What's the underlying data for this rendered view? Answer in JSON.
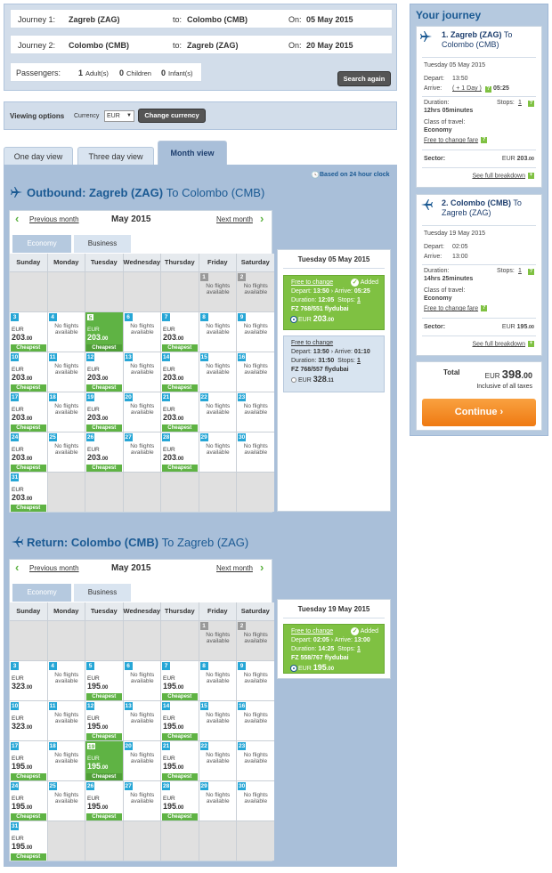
{
  "search": {
    "journey1": {
      "label": "Journey 1:",
      "from": "Zagreb (ZAG)",
      "to_label": "to:",
      "to": "Colombo (CMB)",
      "on_label": "On:",
      "date": "05 May 2015"
    },
    "journey2": {
      "label": "Journey 2:",
      "from": "Colombo (CMB)",
      "to_label": "to:",
      "to": "Zagreb (ZAG)",
      "on_label": "On:",
      "date": "20 May 2015"
    },
    "passengers": {
      "label": "Passengers:",
      "adults": "1",
      "adults_label": "Adult(s)",
      "children": "0",
      "children_label": "Children",
      "infants": "0",
      "infants_label": "Infant(s)"
    },
    "search_again": "Search again"
  },
  "viewing": {
    "label": "Viewing options",
    "currency_label": "Currency",
    "currency": "EUR",
    "change_btn": "Change currency"
  },
  "tabs": [
    "One day view",
    "Three day view",
    "Month view"
  ],
  "clock_note": "Based on 24 hour clock",
  "outbound": {
    "prefix": "Outbound:",
    "from": "Zagreb (ZAG)",
    "to_word": "To",
    "to": "Colombo (CMB)"
  },
  "return": {
    "prefix": "Return:",
    "from": "Colombo (CMB)",
    "to_word": "To",
    "to": "Zagreb (ZAG)"
  },
  "calendar": {
    "prev": "Previous month",
    "next": "Next month",
    "month": "May 2015",
    "cabin_tabs": [
      "Economy",
      "Business"
    ],
    "days": [
      "Sunday",
      "Monday",
      "Tuesday",
      "Wednesday",
      "Thursday",
      "Friday",
      "Saturday"
    ],
    "no_flights": "No flights available",
    "cheapest": "Cheapest",
    "currency": "EUR"
  },
  "out_cells": [
    {
      "d": ""
    },
    {
      "d": ""
    },
    {
      "d": ""
    },
    {
      "d": ""
    },
    {
      "d": ""
    },
    {
      "d": "1",
      "nf": 1
    },
    {
      "d": "2",
      "nf": 1
    },
    {
      "d": "3",
      "p": "203",
      "c": "00",
      "ch": 1
    },
    {
      "d": "4",
      "nf": 1
    },
    {
      "d": "5",
      "p": "203",
      "c": "00",
      "ch": 1,
      "sel": 1
    },
    {
      "d": "6",
      "nf": 1
    },
    {
      "d": "7",
      "p": "203",
      "c": "00",
      "ch": 1
    },
    {
      "d": "8",
      "nf": 1
    },
    {
      "d": "9",
      "nf": 1
    },
    {
      "d": "10",
      "p": "203",
      "c": "00",
      "ch": 1
    },
    {
      "d": "11",
      "nf": 1
    },
    {
      "d": "12",
      "p": "203",
      "c": "00",
      "ch": 1
    },
    {
      "d": "13",
      "nf": 1
    },
    {
      "d": "14",
      "p": "203",
      "c": "00",
      "ch": 1
    },
    {
      "d": "15",
      "nf": 1
    },
    {
      "d": "16",
      "nf": 1
    },
    {
      "d": "17",
      "p": "203",
      "c": "00",
      "ch": 1
    },
    {
      "d": "18",
      "nf": 1
    },
    {
      "d": "19",
      "p": "203",
      "c": "00",
      "ch": 1
    },
    {
      "d": "20",
      "nf": 1
    },
    {
      "d": "21",
      "p": "203",
      "c": "00",
      "ch": 1
    },
    {
      "d": "22",
      "nf": 1
    },
    {
      "d": "23",
      "nf": 1
    },
    {
      "d": "24",
      "p": "203",
      "c": "00",
      "ch": 1
    },
    {
      "d": "25",
      "nf": 1
    },
    {
      "d": "26",
      "p": "203",
      "c": "00",
      "ch": 1
    },
    {
      "d": "27",
      "nf": 1
    },
    {
      "d": "28",
      "p": "203",
      "c": "00",
      "ch": 1
    },
    {
      "d": "29",
      "nf": 1
    },
    {
      "d": "30",
      "nf": 1
    },
    {
      "d": "31",
      "p": "203",
      "c": "00",
      "ch": 1
    },
    {
      "d": ""
    },
    {
      "d": ""
    },
    {
      "d": ""
    },
    {
      "d": ""
    },
    {
      "d": ""
    },
    {
      "d": ""
    }
  ],
  "ret_cells": [
    {
      "d": ""
    },
    {
      "d": ""
    },
    {
      "d": ""
    },
    {
      "d": ""
    },
    {
      "d": ""
    },
    {
      "d": "1",
      "nf": 1
    },
    {
      "d": "2",
      "nf": 1
    },
    {
      "d": "3",
      "p": "323",
      "c": "00"
    },
    {
      "d": "4",
      "nf": 1
    },
    {
      "d": "5",
      "p": "195",
      "c": "00",
      "ch": 1
    },
    {
      "d": "6",
      "nf": 1
    },
    {
      "d": "7",
      "p": "195",
      "c": "00",
      "ch": 1
    },
    {
      "d": "8",
      "nf": 1
    },
    {
      "d": "9",
      "nf": 1
    },
    {
      "d": "10",
      "p": "323",
      "c": "00"
    },
    {
      "d": "11",
      "nf": 1
    },
    {
      "d": "12",
      "p": "195",
      "c": "00",
      "ch": 1
    },
    {
      "d": "13",
      "nf": 1
    },
    {
      "d": "14",
      "p": "195",
      "c": "00",
      "ch": 1
    },
    {
      "d": "15",
      "nf": 1
    },
    {
      "d": "16",
      "nf": 1
    },
    {
      "d": "17",
      "p": "195",
      "c": "00",
      "ch": 1
    },
    {
      "d": "18",
      "nf": 1
    },
    {
      "d": "19",
      "p": "195",
      "c": "00",
      "ch": 1,
      "sel": 1
    },
    {
      "d": "20",
      "nf": 1
    },
    {
      "d": "21",
      "p": "195",
      "c": "00",
      "ch": 1
    },
    {
      "d": "22",
      "nf": 1
    },
    {
      "d": "23",
      "nf": 1
    },
    {
      "d": "24",
      "p": "195",
      "c": "00",
      "ch": 1
    },
    {
      "d": "25",
      "nf": 1
    },
    {
      "d": "26",
      "p": "195",
      "c": "00",
      "ch": 1
    },
    {
      "d": "27",
      "nf": 1
    },
    {
      "d": "28",
      "p": "195",
      "c": "00",
      "ch": 1
    },
    {
      "d": "29",
      "nf": 1
    },
    {
      "d": "30",
      "nf": 1
    },
    {
      "d": "31",
      "p": "195",
      "c": "00",
      "ch": 1
    },
    {
      "d": ""
    },
    {
      "d": ""
    },
    {
      "d": ""
    },
    {
      "d": ""
    },
    {
      "d": ""
    },
    {
      "d": ""
    }
  ],
  "out_day": {
    "title": "Tuesday 05 May 2015",
    "opt1": {
      "free": "Free to change",
      "added": "Added",
      "depart_label": "Depart:",
      "depart": "13:50",
      "arrive_label": "Arrive:",
      "arrive": "05:25",
      "duration_label": "Duration:",
      "duration": "12:05",
      "stops_label": "Stops:",
      "stops": "1",
      "flight": "FZ 768/551 flydubai",
      "cur": "EUR",
      "price": "203",
      "cents": ".00"
    },
    "opt2": {
      "free": "Free to change",
      "depart_label": "Depart:",
      "depart": "13:50",
      "arrive_label": "Arrive:",
      "arrive": "01:10",
      "duration_label": "Duration:",
      "duration": "31:50",
      "stops_label": "Stops:",
      "stops": "1",
      "flight": "FZ 768/557 flydubai",
      "cur": "EUR",
      "price": "328",
      "cents": ".11"
    }
  },
  "ret_day": {
    "title": "Tuesday 19 May 2015",
    "opt1": {
      "free": "Free to change",
      "added": "Added",
      "depart_label": "Depart:",
      "depart": "02:05",
      "arrive_label": "Arrive:",
      "arrive": "13:00",
      "duration_label": "Duration:",
      "duration": "14:25",
      "stops_label": "Stops:",
      "stops": "1",
      "flight": "FZ 558/767 flydubai",
      "cur": "EUR",
      "price": "195",
      "cents": ".00"
    }
  },
  "journey": {
    "title": "Your journey",
    "leg1": {
      "head": "1. Zagreb (ZAG)",
      "to": "To",
      "dest": "Colombo (CMB)",
      "date": "Tuesday 05 May 2015",
      "depart_label": "Depart:",
      "depart": "13:50",
      "arrive_label": "Arrive:",
      "plus_day": "( + 1 Day )",
      "arrive": "05:25",
      "duration_label": "Duration:",
      "duration": "12hrs 05minutes",
      "stops_label": "Stops:",
      "stops": "1",
      "class_label": "Class of travel:",
      "class": "Economy",
      "free": "Free to change fare",
      "sector_label": "Sector:",
      "sector_cur": "EUR",
      "sector_price": "203",
      "sector_cents": ".00",
      "breakdown": "See full breakdown"
    },
    "leg2": {
      "head": "2. Colombo (CMB)",
      "to": "To",
      "dest": "Zagreb (ZAG)",
      "date": "Tuesday 19 May 2015",
      "depart_label": "Depart:",
      "depart": "02:05",
      "arrive_label": "Arrive:",
      "arrive": "13:00",
      "duration_label": "Duration:",
      "duration": "14hrs 25minutes",
      "stops_label": "Stops:",
      "stops": "1",
      "class_label": "Class of travel:",
      "class": "Economy",
      "free": "Free to change fare",
      "sector_label": "Sector:",
      "sector_cur": "EUR",
      "sector_price": "195",
      "sector_cents": ".00",
      "breakdown": "See full breakdown"
    },
    "total_label": "Total",
    "total_cur": "EUR",
    "total": "398",
    "total_cents": ".00",
    "taxes": "Inclusive of all taxes",
    "continue": "Continue"
  },
  "colors": {
    "accent": "#1b5a93",
    "green": "#5fb344",
    "day_blue": "#26a6d6",
    "orange": "#ef7a12"
  }
}
